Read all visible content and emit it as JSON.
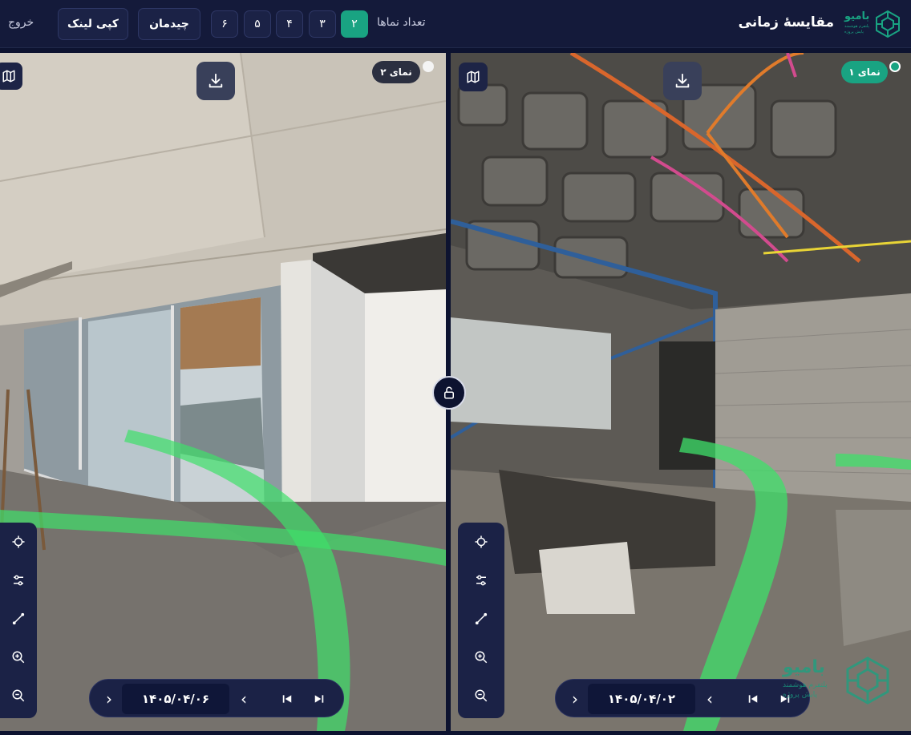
{
  "header": {
    "brand": "بامیو",
    "brand_tagline_1": "پلتفرم هوشمند",
    "brand_tagline_2": "پایش پروژه",
    "title": "مقایسهٔ زمانی",
    "count_label": "تعداد نماها",
    "counts": [
      "۲",
      "۳",
      "۴",
      "۵",
      "۶"
    ],
    "active_count": "۲",
    "layout_label": "چیدمان",
    "copy_link_label": "کپی لینک",
    "exit_label": "خروج"
  },
  "view1": {
    "badge": "نمای ۱",
    "date": "۱۴۰۵/۰۴/۰۲",
    "prev": "‹",
    "next": "›",
    "status": "active"
  },
  "view2": {
    "badge": "نمای ۲",
    "date": "۱۴۰۵/۰۴/۰۶",
    "prev": "‹",
    "next": "›",
    "status": "inactive"
  },
  "watermark": {
    "name": "بامیو",
    "tagline_1": "پلتفرم هوشمند",
    "tagline_2": "پایش پروژه"
  },
  "tools": [
    "crosshair-icon",
    "sliders-icon",
    "measure-icon",
    "zoom-in-icon",
    "zoom-out-icon"
  ],
  "colors": {
    "accent": "#19a382",
    "background": "#0d1330",
    "panel": "#1b2246",
    "path": "#3fe06a"
  }
}
